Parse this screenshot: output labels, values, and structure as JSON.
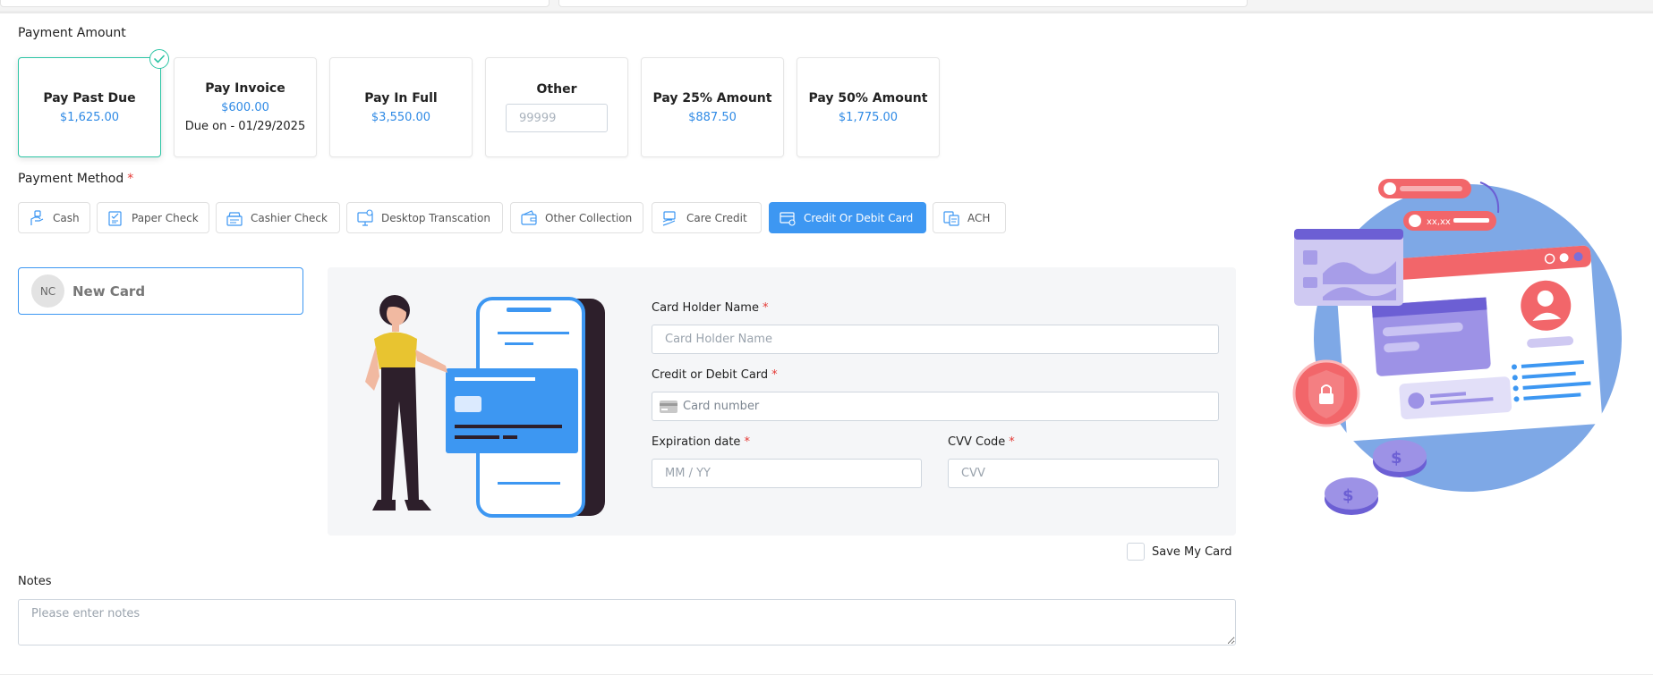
{
  "payment_amount": {
    "label": "Payment Amount",
    "options": [
      {
        "title": "Pay Past Due",
        "value": "$1,625.00",
        "selected": true
      },
      {
        "title": "Pay Invoice",
        "value": "$600.00",
        "due": "Due on - 01/29/2025"
      },
      {
        "title": "Pay In Full",
        "value": "$3,550.00"
      },
      {
        "title": "Other",
        "placeholder": "99999"
      },
      {
        "title": "Pay 25% Amount",
        "value": "$887.50"
      },
      {
        "title": "Pay 50% Amount",
        "value": "$1,775.00"
      }
    ]
  },
  "payment_method": {
    "label": "Payment Method",
    "required_mark": "*",
    "methods": [
      {
        "label": "Cash",
        "icon": "cash-hand-icon"
      },
      {
        "label": "Paper Check",
        "icon": "paper-check-icon"
      },
      {
        "label": "Cashier Check",
        "icon": "cashier-check-icon"
      },
      {
        "label": "Desktop Transcation",
        "icon": "desktop-transaction-icon"
      },
      {
        "label": "Other Collection",
        "icon": "wallet-icon"
      },
      {
        "label": "Care Credit",
        "icon": "care-credit-icon"
      },
      {
        "label": "Credit Or Debit Card",
        "icon": "credit-card-icon",
        "active": true
      },
      {
        "label": "ACH",
        "icon": "ach-bank-icon"
      }
    ]
  },
  "saved_card": {
    "initials": "NC",
    "label": "New Card"
  },
  "card_form": {
    "holder_label": "Card Holder Name",
    "holder_placeholder": "Card Holder Name",
    "card_label": "Credit or Debit Card",
    "card_placeholder": "Card number",
    "exp_label": "Expiration date",
    "exp_placeholder": "MM / YY",
    "cvv_label": "CVV Code",
    "cvv_placeholder": "CVV",
    "required_mark": "*"
  },
  "save_card_label": "Save My Card",
  "notes": {
    "label": "Notes",
    "placeholder": "Please enter notes"
  },
  "illustration": {
    "mini_text": "xx,xx"
  },
  "colors": {
    "accent": "#3d97f2",
    "selected_border": "#2bc4a4",
    "required": "#e53935",
    "amount_value": "#2f8ae5"
  }
}
